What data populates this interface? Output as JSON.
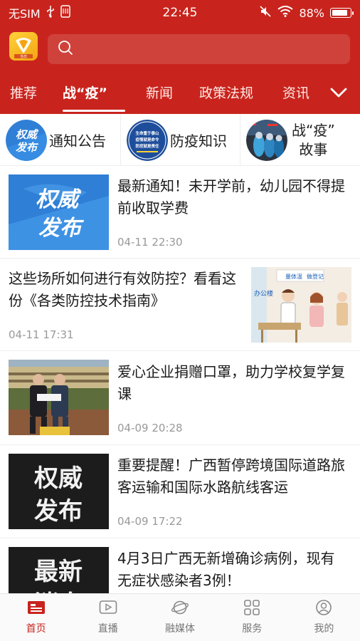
{
  "status_bar": {
    "carrier": "无SIM",
    "time": "22:45",
    "battery": "88%",
    "battery_level": 0.88
  },
  "header": {
    "logo_caption": "当日",
    "search": {
      "placeholder": ""
    }
  },
  "tabs": [
    "推荐",
    "战“疫”",
    "新闻",
    "政策法规",
    "资讯"
  ],
  "active_tab": "战“疫”",
  "quick_entries": [
    {
      "label": "通知公告",
      "icon": "authority-release-icon",
      "icon_text": [
        "权威",
        "发布"
      ]
    },
    {
      "label": "防疫知识",
      "icon": "prevention-poster-icon",
      "icon_text": [
        "生命重于泰山",
        "疫情就是命令",
        "防控就是责任"
      ]
    },
    {
      "label_lines": [
        "战“疫”",
        "故事"
      ],
      "icon": "medical-staff-photo-icon"
    }
  ],
  "news": [
    {
      "title": "最新通知！未开学前，幼儿园不得提前收取学费",
      "time": "04-11 22:30",
      "thumb": "authority-release-image",
      "thumb_text": [
        "权威",
        "发布"
      ]
    },
    {
      "title": "这些场所如何进行有效防控？看看这份《各类防控技术指南》",
      "time": "04-11 17:31",
      "thumb": "temperature-check-illustration",
      "thumb_text": [
        "量体温",
        "做登记",
        "办公楼"
      ]
    },
    {
      "title": "爱心企业捐赠口罩，助力学校复学复课",
      "time": "04-09 20:28",
      "thumb": "mask-donation-photo"
    },
    {
      "title": "重要提醒！广西暂停跨境国际道路旅客运输和国际水路航线客运",
      "time": "04-09 17:22",
      "thumb": "authority-release-dark-image",
      "thumb_text": [
        "权威",
        "发布"
      ]
    },
    {
      "title": "4月3日广西无新增确诊病例，现有无症状感染者3例！",
      "time": "",
      "thumb": "latest-news-dark-image",
      "thumb_text": [
        "最新",
        "消息"
      ]
    }
  ],
  "bottom_nav": [
    "首页",
    "直播",
    "融媒体",
    "服务",
    "我的"
  ],
  "bottom_nav_active": "首页",
  "colors": {
    "brand_red": "#c8241d",
    "thumb_blue": "#2f7fd6",
    "text_gray": "#999999"
  }
}
